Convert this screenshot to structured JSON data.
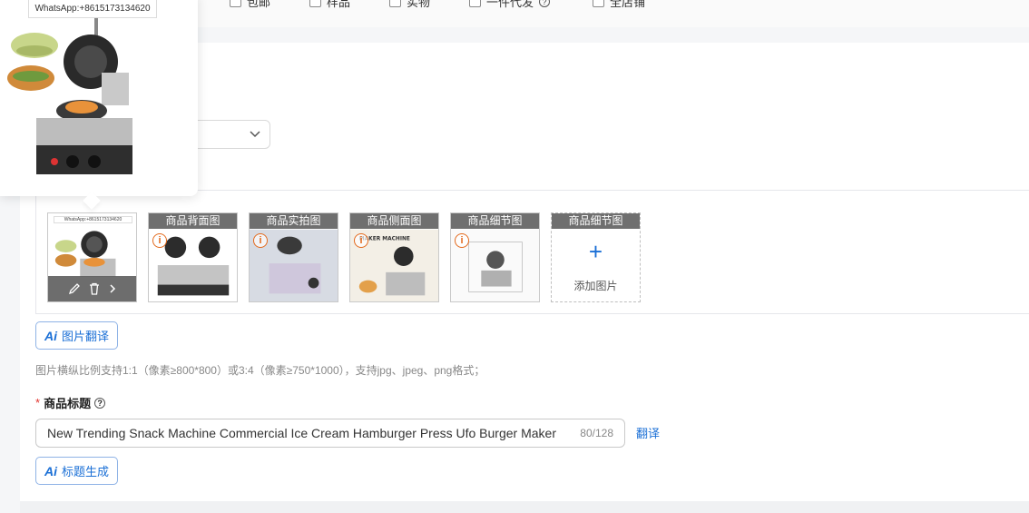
{
  "filters": {
    "items": [
      {
        "label": "包邮"
      },
      {
        "label": "样品"
      },
      {
        "label": "实物"
      },
      {
        "label": "一件代发"
      },
      {
        "label": "全店铺"
      }
    ]
  },
  "images": {
    "preview_watermark": "WhatsApp:+8615173134620",
    "thumbnails": [
      {
        "label": ""
      },
      {
        "label": "商品背面图"
      },
      {
        "label": "商品实拍图"
      },
      {
        "label": "商品侧面图"
      },
      {
        "label": "商品细节图"
      }
    ],
    "add_slot": {
      "label": "商品细节图",
      "plus": "+",
      "text": "添加图片"
    },
    "side_thumb_text": "MAKER MACHINE"
  },
  "buttons": {
    "image_translate": "图片翻译",
    "title_generate": "标题生成",
    "ai_mark": "Ai"
  },
  "hint_text": "图片横纵比例支持1:1（像素≥800*800）或3:4（像素≥750*1000），支持jpg、jpeg、png格式；",
  "title_field": {
    "label": "商品标题",
    "required_mark": "*",
    "value": "New Trending Snack Machine Commercial Ice Cream Hamburger Press Ufo Burger Maker",
    "count": "80/128",
    "translate": "翻译"
  },
  "colors": {
    "accent": "#1a6fd6",
    "warning": "#e36a1d",
    "required": "#e3322d"
  }
}
